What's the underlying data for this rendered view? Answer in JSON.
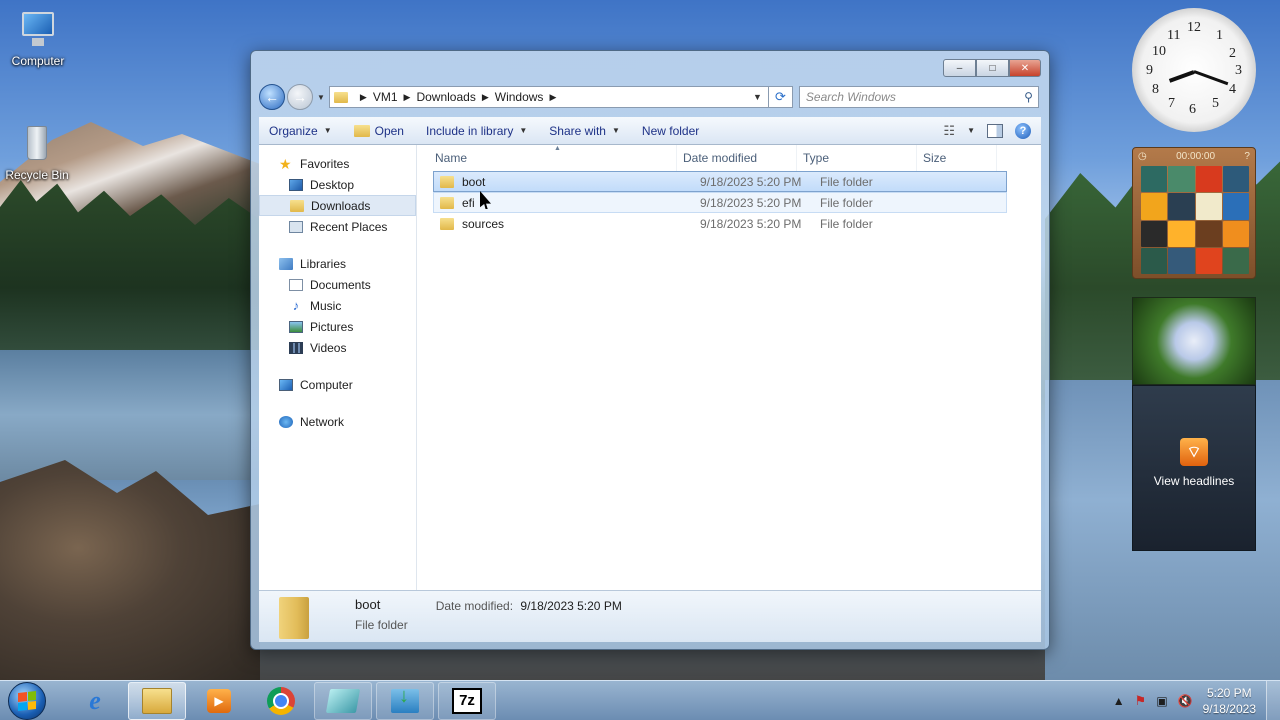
{
  "desktop": {
    "icons": [
      {
        "label": "Computer"
      },
      {
        "label": "Recycle Bin"
      }
    ]
  },
  "window": {
    "controls": {
      "minimize": "–",
      "maximize": "□",
      "close": "✕"
    },
    "nav": {
      "back_icon": "arrow-left",
      "forward_icon": "arrow-right"
    },
    "breadcrumb": [
      "VM1",
      "Downloads",
      "Windows"
    ],
    "search": {
      "placeholder": "Search Windows"
    },
    "commands": {
      "organize": "Organize",
      "open": "Open",
      "include_in_library": "Include in library",
      "share_with": "Share with",
      "new_folder": "New folder"
    },
    "nav_pane": {
      "favorites": {
        "label": "Favorites",
        "items": [
          "Desktop",
          "Downloads",
          "Recent Places"
        ]
      },
      "libraries": {
        "label": "Libraries",
        "items": [
          "Documents",
          "Music",
          "Pictures",
          "Videos"
        ]
      },
      "computer": "Computer",
      "network": "Network",
      "selected": "Downloads"
    },
    "columns": {
      "name": "Name",
      "date": "Date modified",
      "type": "Type",
      "size": "Size"
    },
    "files": [
      {
        "name": "boot",
        "date": "9/18/2023 5:20 PM",
        "type": "File folder",
        "state": "selected"
      },
      {
        "name": "efi",
        "date": "9/18/2023 5:20 PM",
        "type": "File folder",
        "state": "hover"
      },
      {
        "name": "sources",
        "date": "9/18/2023 5:20 PM",
        "type": "File folder",
        "state": "normal"
      }
    ],
    "details": {
      "name": "boot",
      "type": "File folder",
      "date_label": "Date modified:",
      "date_value": "9/18/2023 5:20 PM"
    }
  },
  "gadgets": {
    "clock": {
      "numbers": [
        "12",
        "1",
        "2",
        "3",
        "4",
        "5",
        "6",
        "7",
        "8",
        "9",
        "10",
        "11"
      ],
      "time": "5:20"
    },
    "puzzle": {
      "timer": "00:00:00"
    },
    "feed": {
      "label": "View headlines"
    }
  },
  "taskbar": {
    "apps": [
      "Internet Explorer",
      "Windows Explorer",
      "Windows Media Player",
      "Google Chrome",
      "Notepad",
      "Installer",
      "7-Zip"
    ],
    "active": "Windows Explorer",
    "sevenz_label": "7z",
    "time": "5:20 PM",
    "date": "9/18/2023"
  }
}
